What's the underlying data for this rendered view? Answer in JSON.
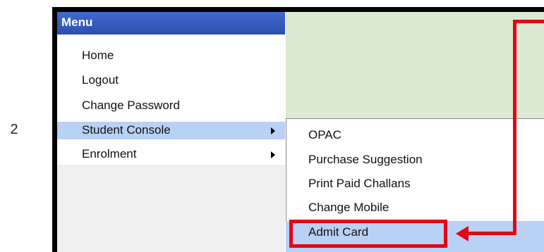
{
  "step_label": "2",
  "menu": {
    "title": "Menu",
    "items": [
      {
        "label": "Home"
      },
      {
        "label": "Logout"
      },
      {
        "label": "Change Password"
      },
      {
        "label": "Student Console"
      },
      {
        "label": "Enrolment"
      }
    ]
  },
  "submenu": {
    "items": [
      {
        "label": "OPAC"
      },
      {
        "label": "Purchase Suggestion"
      },
      {
        "label": "Print Paid Challans"
      },
      {
        "label": "Change Mobile"
      },
      {
        "label": "Admit Card"
      }
    ]
  },
  "colors": {
    "header_blue": "#2c4fae",
    "highlight_blue": "#b8d1f4",
    "green_panel": "#dbe8d2",
    "annotation_red": "#e30613"
  }
}
